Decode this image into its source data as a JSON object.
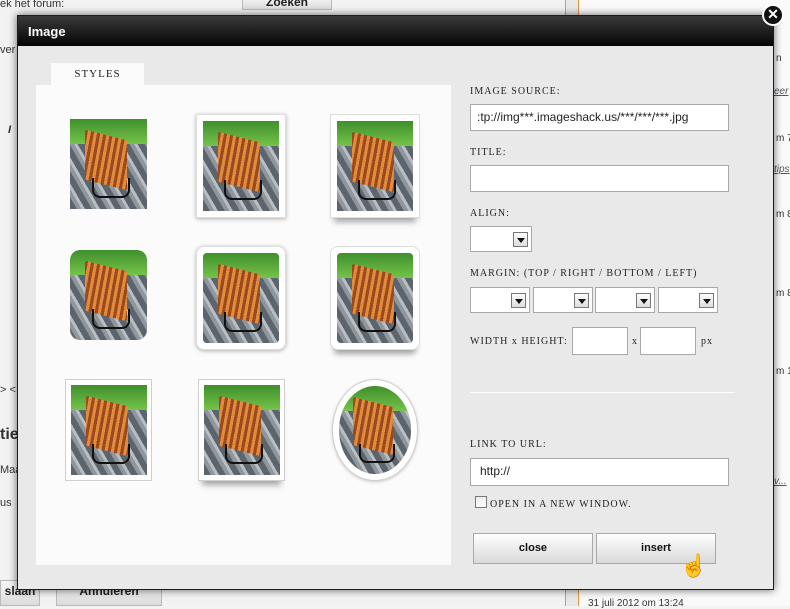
{
  "background": {
    "forum_text": "ek het forum:",
    "search_button": "Zoeken",
    "left_fragment_1": "ver",
    "left_fragment_2": "I",
    "left_fragment_3": "> <",
    "left_heading": "tie",
    "left_text_1": "Maa",
    "left_text_2": "us",
    "save_button": "slaan",
    "cancel_button": "Annuleren",
    "right_fragments": [
      "n",
      "eer",
      "m 7",
      "tips",
      "m 8",
      "m 8",
      "m 1",
      "v...",
      "31 juli 2012 om 13:24"
    ]
  },
  "dialog": {
    "title": "Image",
    "close_icon": "close-icon",
    "tab_styles": "STYLES",
    "image_source_label": "IMAGE SOURCE:",
    "image_source_value": ":tp://img***.imageshack.us/***/***/***.jpg",
    "title_label": "TITLE:",
    "title_value": "",
    "align_label": "ALIGN:",
    "align_value": "",
    "margin_label": "MARGIN: (TOP / RIGHT / BOTTOM / LEFT)",
    "margin_values": [
      "",
      "",
      "",
      ""
    ],
    "size_label": "WIDTH x HEIGHT:",
    "size_separator": "x",
    "size_unit": "px",
    "width_value": "",
    "height_value": "",
    "link_label": "LINK TO URL:",
    "link_value": "http://",
    "new_window_label": "OPEN IN A NEW WINDOW.",
    "new_window_checked": false,
    "close_button": "close",
    "insert_button": "insert"
  },
  "styles": [
    {
      "name": "plain"
    },
    {
      "name": "white-frame"
    },
    {
      "name": "white-frame-shadow"
    },
    {
      "name": "rounded"
    },
    {
      "name": "rounded-frame"
    },
    {
      "name": "rounded-frame-shadow"
    },
    {
      "name": "thin-border"
    },
    {
      "name": "thin-border-shadow"
    },
    {
      "name": "oval"
    }
  ]
}
